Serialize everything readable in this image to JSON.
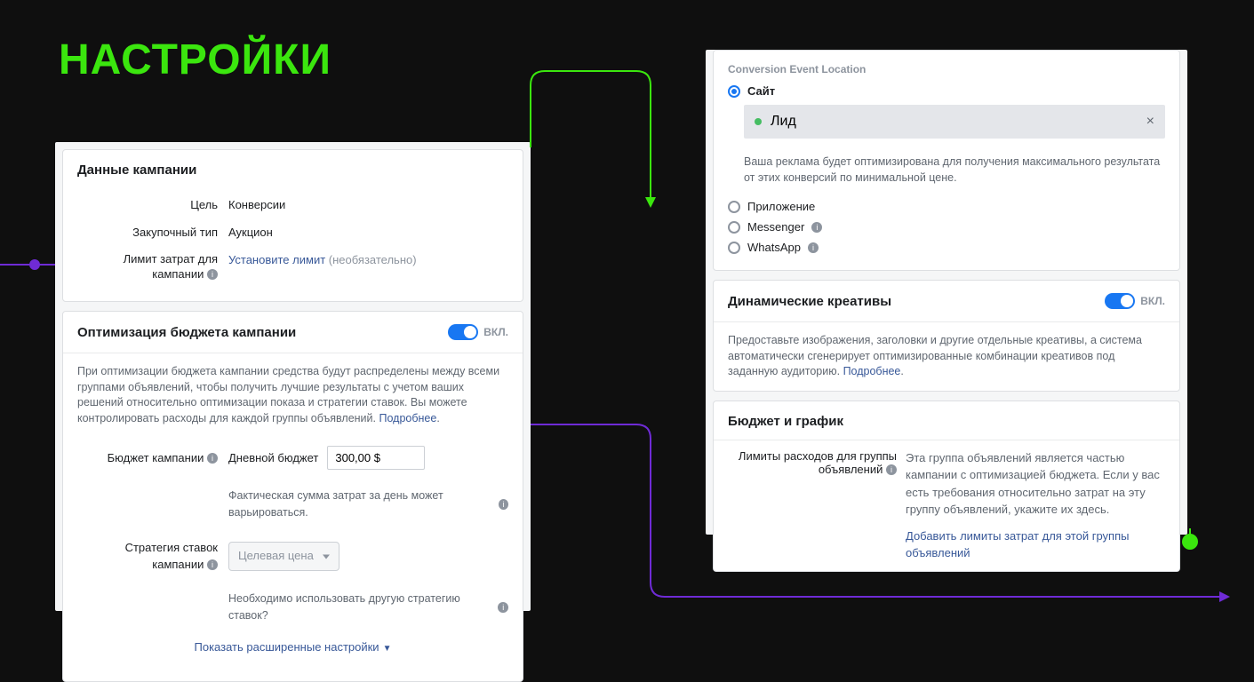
{
  "title": "НАСТРОЙКИ",
  "left": {
    "campaignData": {
      "header": "Данные кампании",
      "goalLabel": "Цель",
      "goalValue": "Конверсии",
      "buyTypeLabel": "Закупочный тип",
      "buyTypeValue": "Аукцион",
      "spendLimitLabel": "Лимит затрат для кампании",
      "spendLimitLink": "Установите лимит",
      "spendLimitOptional": "(необязательно)"
    },
    "budgetOpt": {
      "header": "Оптимизация бюджета кампании",
      "toggleText": "ВКЛ.",
      "desc": "При оптимизации бюджета кампании средства будут распределены между всеми группами объявлений, чтобы получить лучшие результаты с учетом ваших решений относительно оптимизации показа и стратегии ставок. Вы можете контролировать расходы для каждой группы объявлений.",
      "learnMore": "Подробнее",
      "budgetLabel": "Бюджет кампании",
      "budgetType": "Дневной бюджет",
      "budgetValue": "300,00 $",
      "budgetNote": "Фактическая сумма затрат за день может варьироваться.",
      "bidLabel": "Стратегия ставок кампании",
      "bidSelect": "Целевая цена",
      "bidNote": "Необходимо использовать другую стратегию ставок?",
      "advanced": "Показать расширенные настройки"
    }
  },
  "right": {
    "conv": {
      "title": "Conversion Event Location",
      "siteLabel": "Сайт",
      "pillText": "Лид",
      "desc": "Ваша реклама будет оптимизирована для получения максимального результата от этих конверсий по минимальной цене.",
      "appLabel": "Приложение",
      "messengerLabel": "Messenger",
      "whatsappLabel": "WhatsApp"
    },
    "dyn": {
      "header": "Динамические креативы",
      "toggleText": "ВКЛ.",
      "desc": "Предоставьте изображения, заголовки и другие отдельные креативы, а система автоматически сгенерирует оптимизированные комбинации креативов под заданную аудиторию.",
      "learnMore": "Подробнее"
    },
    "budget": {
      "header": "Бюджет и график",
      "limitLabel": "Лимиты расходов для группы объявлений",
      "limitDesc": "Эта группа объявлений является частью кампании с оптимизацией бюджета. Если у вас есть требования относительно затрат на эту группу объявлений, укажите их здесь.",
      "addLink": "Добавить лимиты затрат для этой группы объявлений"
    }
  }
}
